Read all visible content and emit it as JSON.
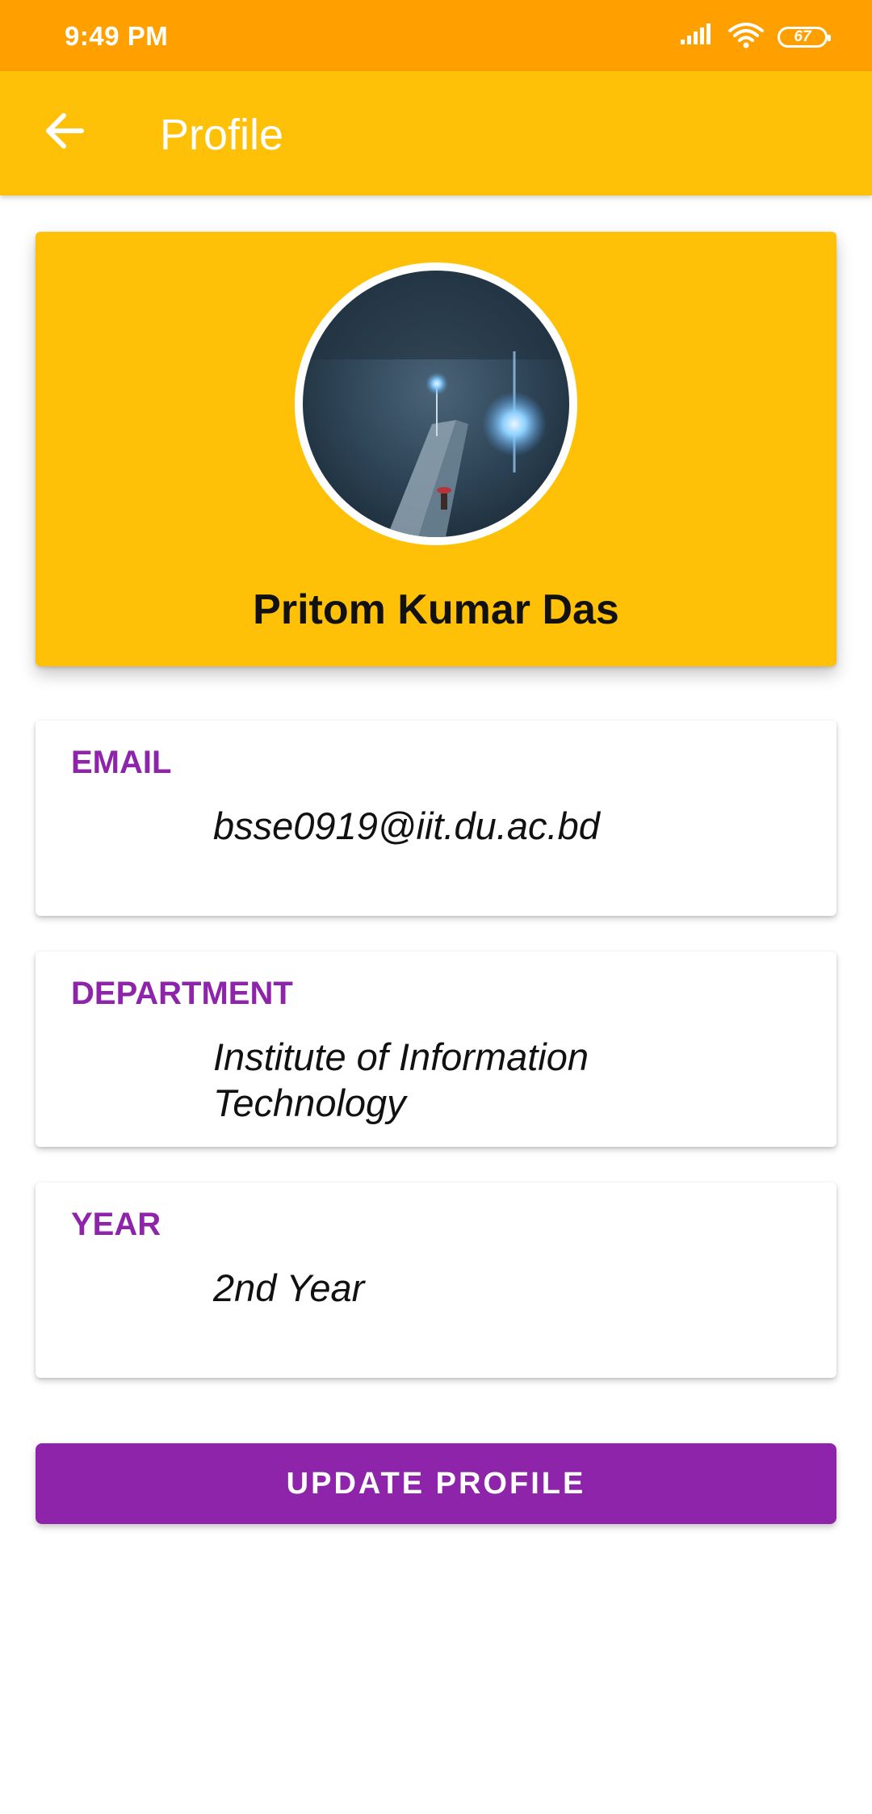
{
  "status_bar": {
    "time": "9:49 PM",
    "battery_level": "67",
    "icons": [
      "signal-icon",
      "wifi-icon",
      "battery-icon"
    ]
  },
  "app_bar": {
    "title": "Profile",
    "back_icon": "arrow-back-icon",
    "color": "#FFC107"
  },
  "profile": {
    "name": "Pritom Kumar Das",
    "avatar": "profile-photo"
  },
  "fields": {
    "email": {
      "label": "EMAIL",
      "value": "bsse0919@iit.du.ac.bd"
    },
    "department": {
      "label": "DEPARTMENT",
      "value": "Institute of Information Technology"
    },
    "year": {
      "label": "YEAR",
      "value": "2nd Year"
    }
  },
  "actions": {
    "update_label": "UPDATE PROFILE"
  },
  "colors": {
    "status_bar": "#FFA000",
    "primary": "#FFC107",
    "accent": "#8E24AA"
  }
}
